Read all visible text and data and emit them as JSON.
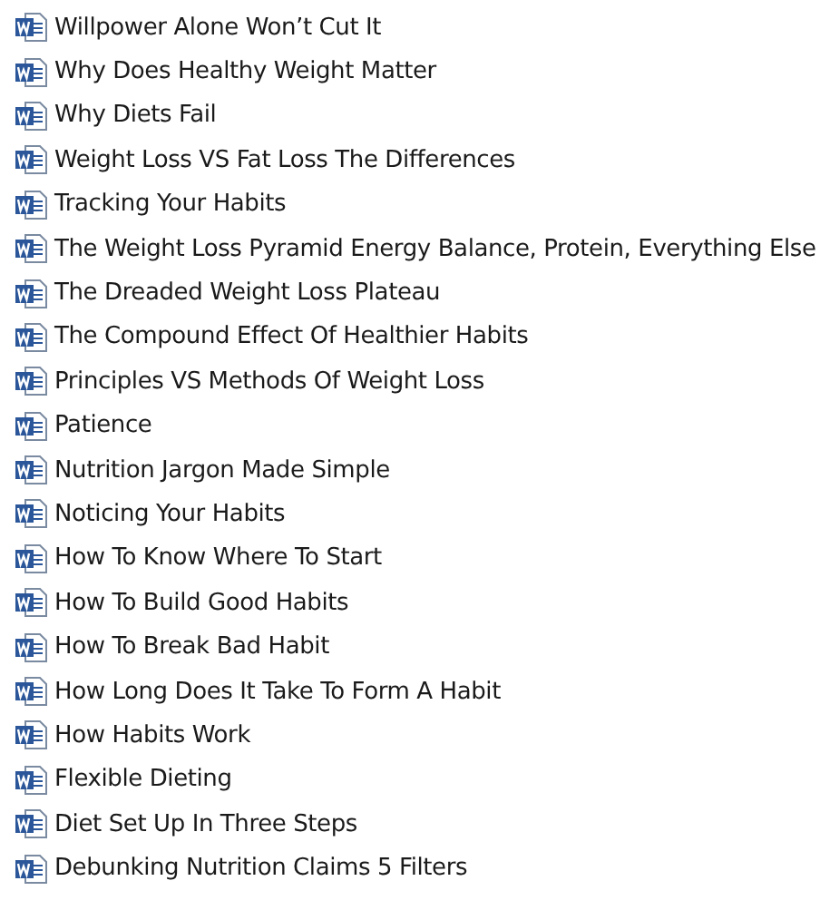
{
  "files": [
    {
      "name": "Willpower Alone Won’t Cut It"
    },
    {
      "name": "Why Does Healthy Weight Matter"
    },
    {
      "name": "Why Diets Fail"
    },
    {
      "name": "Weight Loss VS Fat Loss The Differences"
    },
    {
      "name": "Tracking Your Habits"
    },
    {
      "name": "The Weight Loss Pyramid Energy Balance, Protein, Everything Else"
    },
    {
      "name": "The Dreaded Weight Loss Plateau"
    },
    {
      "name": "The Compound Effect Of Healthier Habits"
    },
    {
      "name": "Principles VS Methods Of Weight Loss"
    },
    {
      "name": "Patience"
    },
    {
      "name": "Nutrition Jargon Made Simple"
    },
    {
      "name": "Noticing Your Habits"
    },
    {
      "name": "How To Know Where To Start"
    },
    {
      "name": "How To Build Good Habits"
    },
    {
      "name": "How To Break Bad Habit"
    },
    {
      "name": "How Long Does It Take To Form A Habit"
    },
    {
      "name": "How Habits Work"
    },
    {
      "name": "Flexible Dieting"
    },
    {
      "name": "Diet Set Up In Three Steps"
    },
    {
      "name": "Debunking Nutrition Claims 5 Filters"
    }
  ]
}
